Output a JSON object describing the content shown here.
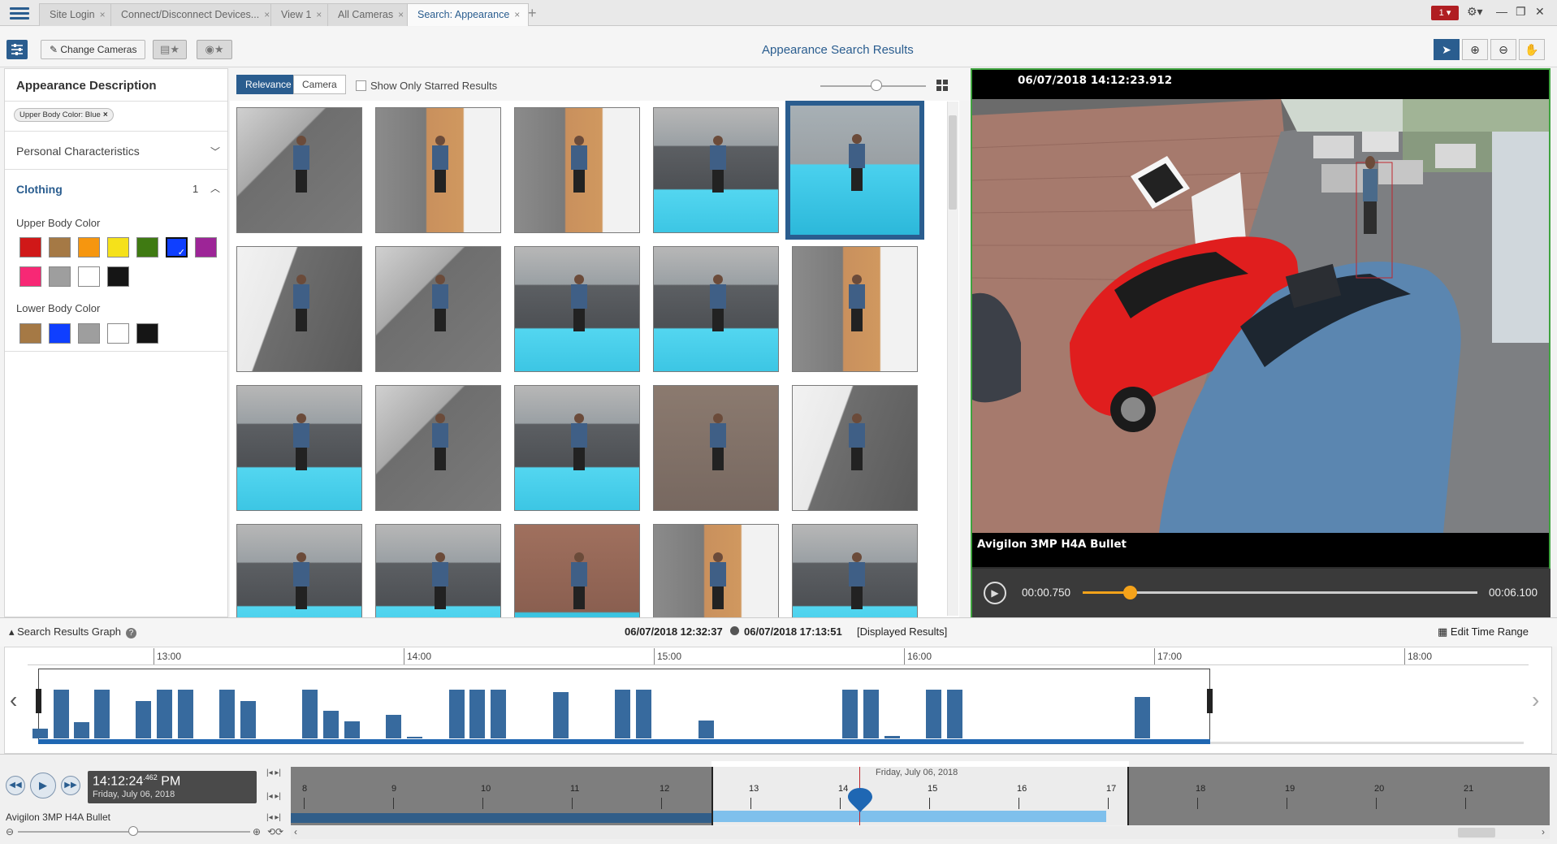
{
  "tabs": [
    {
      "label": "Site Login"
    },
    {
      "label": "Connect/Disconnect Devices..."
    },
    {
      "label": "View 1"
    },
    {
      "label": "All Cameras"
    },
    {
      "label": "Search: Appearance"
    }
  ],
  "tab_close": "×",
  "add_tab": "+",
  "alarm_count": "1 ▾",
  "window_controls": {
    "settings": "⚙▾",
    "minimize": "—",
    "restore": "❐",
    "close": "✕"
  },
  "toolbar": {
    "change_cameras": "Change Cameras",
    "page_title": "Appearance Search Results"
  },
  "left_panel": {
    "heading": "Appearance Description",
    "filter_chip": "Upper Body Color: Blue",
    "chip_close": "×",
    "personal_characteristics": "Personal Characteristics",
    "clothing": "Clothing",
    "clothing_count": "1",
    "upper_body_label": "Upper Body Color",
    "lower_body_label": "Lower Body Color",
    "upper_colors": [
      "#d01818",
      "#a57945",
      "#f6960f",
      "#f5e11a",
      "#3f7a12",
      "#0f3fff",
      "#9d2597",
      "#f72875",
      "#9e9e9e",
      "#ffffff",
      "#151515"
    ],
    "upper_selected": 5,
    "lower_colors": [
      "#a57945",
      "#0f3fff",
      "#9e9e9e",
      "#ffffff",
      "#151515"
    ]
  },
  "results": {
    "sort_relevance": "Relevance",
    "sort_camera": "Camera",
    "starred_only": "Show Only Starred Results"
  },
  "video": {
    "timestamp": "06/07/2018 14:12:23.912",
    "camera_name": "Avigilon 3MP H4A Bullet",
    "current_time": "00:00.750",
    "duration": "00:06.100",
    "progress": 0.12
  },
  "graph": {
    "title": "Search Results Graph",
    "range_start": "06/07/2018 12:32:37",
    "range_end": "06/07/2018 17:13:51",
    "displayed": "[Displayed Results]",
    "edit_time_range": "Edit Time Range",
    "hour_labels": [
      "13:00",
      "14:00",
      "15:00",
      "16:00",
      "17:00",
      "18:00"
    ]
  },
  "timeline": {
    "clock_time": "14:12:24",
    "clock_ms": ".462",
    "clock_ampm": "PM",
    "clock_date": "Friday, July 06, 2018",
    "camera_label": "Avigilon 3MP H4A Bullet",
    "day_label": "Friday, July 06, 2018",
    "hours": [
      "8",
      "9",
      "10",
      "11",
      "12",
      "13",
      "14",
      "15",
      "16",
      "17",
      "18",
      "19",
      "20",
      "21"
    ]
  },
  "icons": {
    "menu": "hamburger-icon",
    "panel_toggle": "sliders-icon",
    "pointer": "cursor-arrow-icon",
    "zoom_in": "zoom-in-icon",
    "zoom_out": "zoom-out-icon",
    "pan": "hand-icon",
    "calendar": "calendar-icon"
  }
}
